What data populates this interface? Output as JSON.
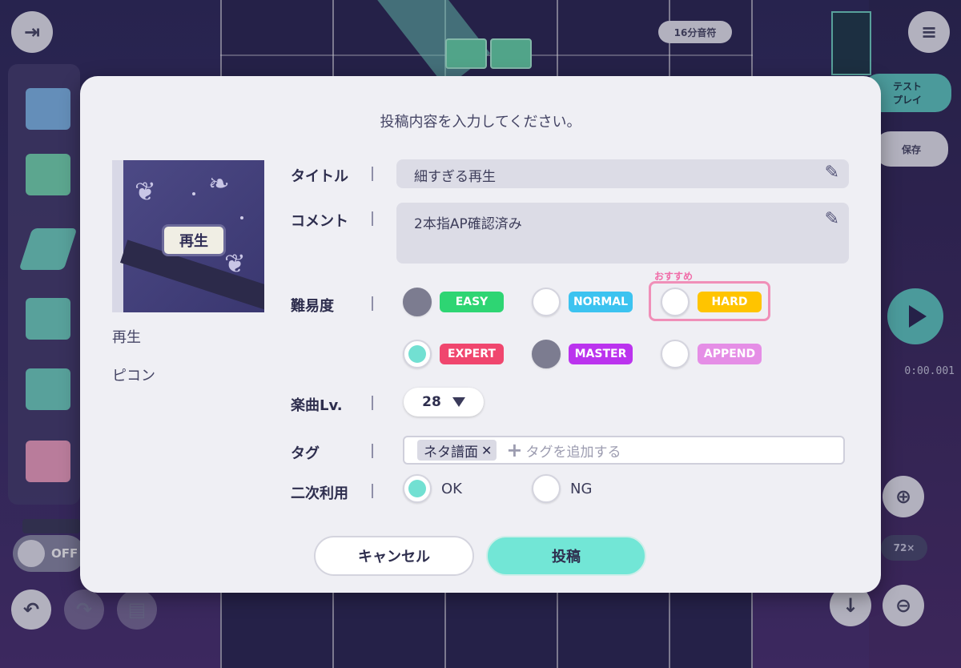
{
  "editor": {
    "beat_label": "16分音符",
    "test_play_label": "テスト\nプレイ",
    "save_label": "保存",
    "toggle_label": "OFF",
    "time_display": "0:00.001",
    "speed_label": "72×"
  },
  "modal": {
    "title": "投稿内容を入力してください。",
    "jacket_text": "再生",
    "song_name": "再生",
    "artist": "ピコン",
    "fields": {
      "title_label": "タイトル",
      "title_value": "細すぎる再生",
      "comment_label": "コメント",
      "comment_value": "2本指AP確認済み",
      "difficulty_label": "難易度",
      "level_label": "楽曲Lv.",
      "level_value": "28",
      "tag_label": "タグ",
      "tag_chip": "ネタ譜面",
      "tag_placeholder": "タグを追加する",
      "reuse_label": "二次利用"
    },
    "recommend_label": "おすすめ",
    "difficulties": [
      {
        "label": "EASY",
        "color": "#2ed573",
        "state": "filled"
      },
      {
        "label": "NORMAL",
        "color": "#3cc3f0",
        "state": "empty"
      },
      {
        "label": "HARD",
        "color": "#ffc400",
        "state": "empty"
      },
      {
        "label": "EXPERT",
        "color": "#f0466e",
        "state": "selected"
      },
      {
        "label": "MASTER",
        "color": "#bb33ee",
        "state": "filled"
      },
      {
        "label": "APPEND",
        "color": "#e58ee6",
        "state": "empty"
      }
    ],
    "reuse_options": [
      {
        "label": "OK",
        "state": "selected"
      },
      {
        "label": "NG",
        "state": "empty"
      }
    ],
    "buttons": {
      "cancel": "キャンセル",
      "post": "投稿"
    }
  }
}
